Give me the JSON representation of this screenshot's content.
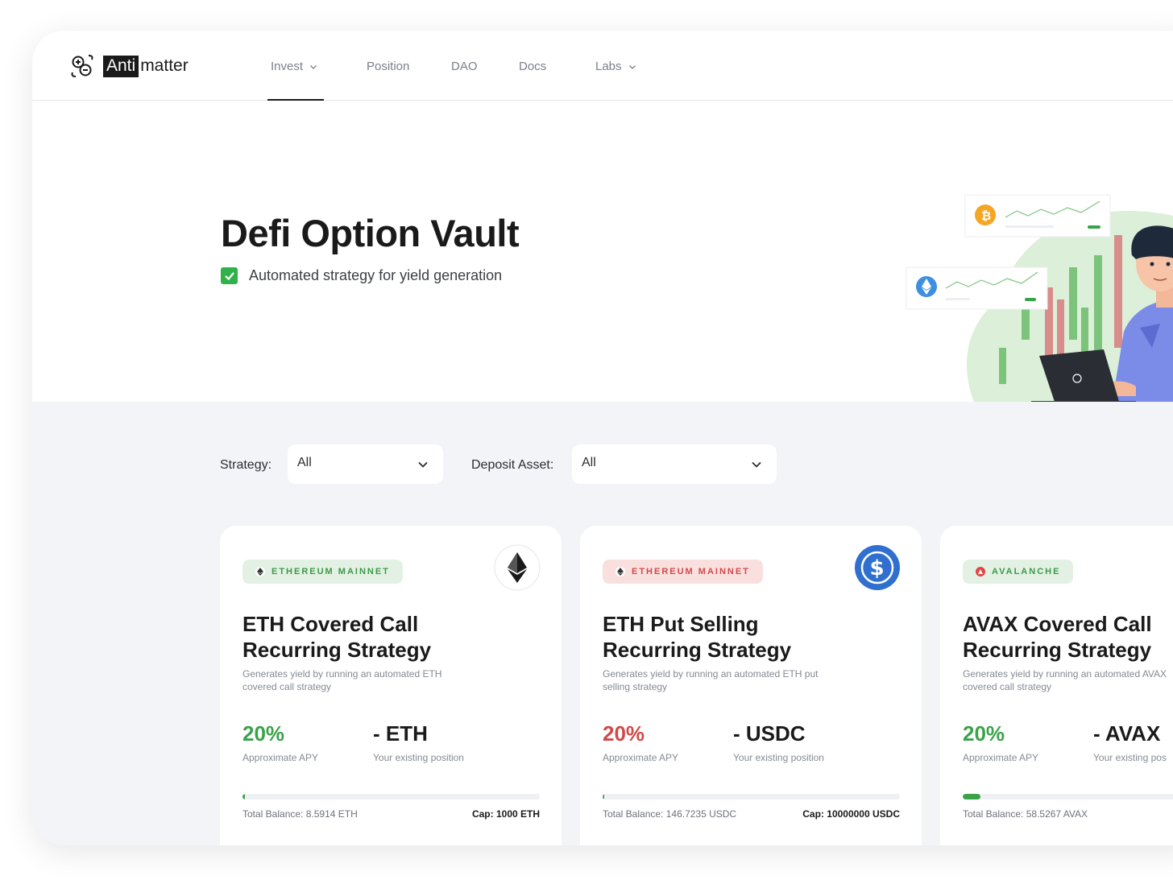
{
  "brand": {
    "anti": "Anti",
    "matter": "matter"
  },
  "nav": {
    "items": [
      {
        "label": "Invest",
        "dropdown": true,
        "active": true
      },
      {
        "label": "Position",
        "dropdown": false
      },
      {
        "label": "DAO",
        "dropdown": false
      },
      {
        "label": "Docs",
        "dropdown": false
      },
      {
        "label": "Labs",
        "dropdown": true
      }
    ]
  },
  "hero": {
    "title": "Defi Option Vault",
    "subtitle": "Automated strategy for yield generation"
  },
  "filters": {
    "strategy": {
      "label": "Strategy:",
      "value": "All"
    },
    "deposit_asset": {
      "label": "Deposit Asset:",
      "value": "All"
    }
  },
  "cards": [
    {
      "network": "ETHEREUM MAINNET",
      "network_icon": "ethereum-icon",
      "badge_color": "#3c9a47",
      "coin_icon": "ethereum-coin-icon",
      "title_line1": "ETH Covered Call",
      "title_line2": "Recurring Strategy",
      "description": "Generates yield by running an automated ETH covered call strategy",
      "apy": "20%",
      "apy_label": "Approximate APY",
      "position": "- ETH",
      "position_label": "Your existing position",
      "progress": 0.0086,
      "total_balance": "Total Balance: 8.5914 ETH",
      "cap": "Cap: 1000 ETH"
    },
    {
      "network": "ETHEREUM MAINNET",
      "network_icon": "ethereum-icon",
      "badge_color": "#d24a48",
      "coin_icon": "usdc-coin-icon",
      "title_line1": "ETH Put Selling",
      "title_line2": "Recurring Strategy",
      "description": "Generates yield by running an automated ETH put selling strategy",
      "apy": "20%",
      "apy_label": "Approximate APY",
      "position": "- USDC",
      "position_label": "Your existing position",
      "progress": 1.47e-05,
      "total_balance": "Total Balance: 146.7235 USDC",
      "cap": "Cap: 10000000 USDC"
    },
    {
      "network": "AVALANCHE",
      "network_icon": "avalanche-icon",
      "badge_color": "#3c9a47",
      "coin_icon": "avalanche-coin-icon",
      "title_line1": "AVAX Covered Call",
      "title_line2": "Recurring Strategy",
      "description": "Generates yield by running an automated AVAX covered call strategy",
      "apy": "20%",
      "apy_label": "Approximate APY",
      "position": "- AVAX",
      "position_label": "Your existing pos",
      "progress": 0.06,
      "total_balance": "Total Balance: 58.5267 AVAX",
      "cap": ""
    }
  ]
}
